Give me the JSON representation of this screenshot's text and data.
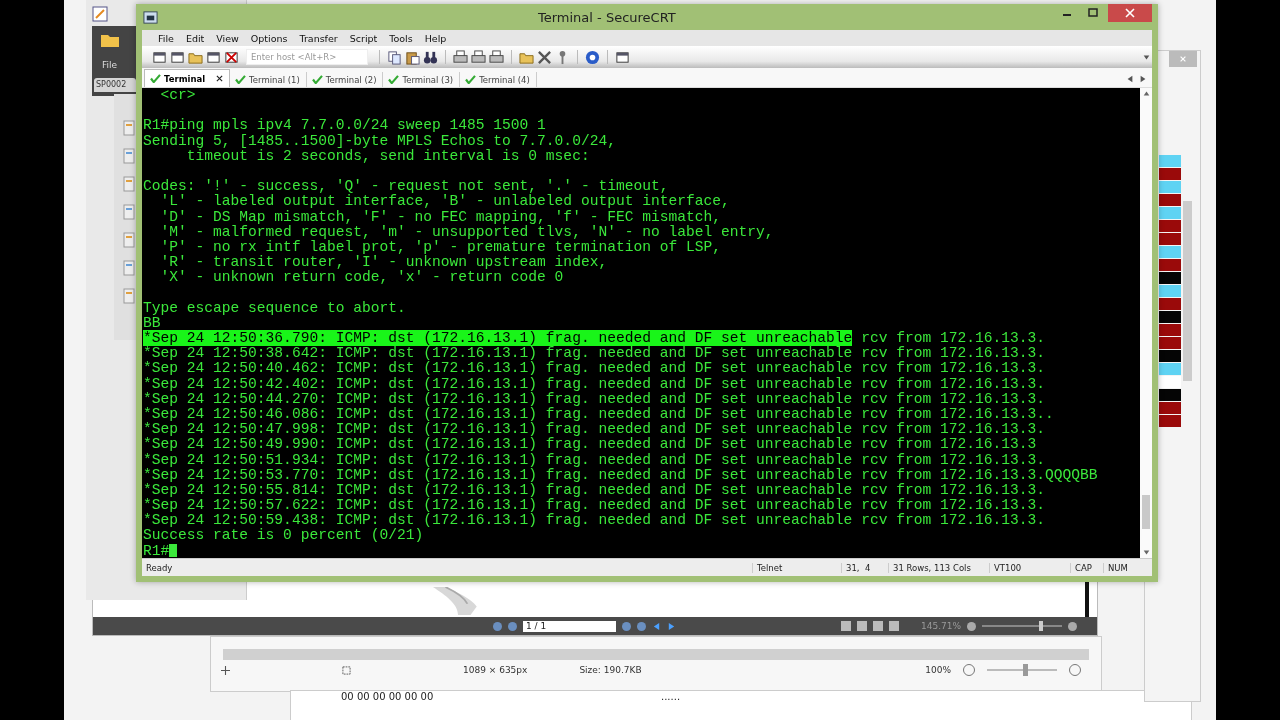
{
  "back_explorer": {
    "menu": "File",
    "tab": "SP0002"
  },
  "pdf_viewer": {
    "page": "1 / 1",
    "zoom": "145.71%",
    "zoom_slider": {
      "level": 0.75
    }
  },
  "image_viewer": {
    "dimensions": "1089 × 635px",
    "size": "Size: 190.7KB",
    "zoom": "100%",
    "zoom_slider": {
      "level": 0.55
    }
  },
  "hex_view": {
    "bytes": "00 00 00 00 00 00",
    "ascii": "......"
  },
  "color_strips": [
    {
      "color": "#5fd3f3"
    },
    {
      "color": "#9a0a0a"
    },
    {
      "color": "#5fd3f3"
    },
    {
      "color": "#9a0a0a"
    },
    {
      "color": "#5fd3f3"
    },
    {
      "color": "#9a0a0a"
    },
    {
      "color": "#9a0a0a"
    },
    {
      "color": "#5fd3f3"
    },
    {
      "color": "#9a0a0a"
    },
    {
      "color": "#050505"
    },
    {
      "color": "#5fd3f3"
    },
    {
      "color": "#9a0a0a"
    },
    {
      "color": "#050505"
    },
    {
      "color": "#9a0a0a"
    },
    {
      "color": "#9a0a0a"
    },
    {
      "color": "#050505"
    },
    {
      "color": "#5fd3f3"
    },
    {
      "color": "#ffffff"
    },
    {
      "color": "#050505"
    },
    {
      "color": "#9a0a0a"
    },
    {
      "color": "#9a0a0a"
    }
  ],
  "window": {
    "title": "Terminal - SecureCRT"
  },
  "menu": [
    "File",
    "Edit",
    "View",
    "Options",
    "Transfer",
    "Script",
    "Tools",
    "Help"
  ],
  "toolbar": {
    "host_placeholder": "Enter host <Alt+R>"
  },
  "tabs": [
    {
      "label": "Terminal",
      "selected": true
    },
    {
      "label": "Terminal (1)",
      "selected": false
    },
    {
      "label": "Terminal (2)",
      "selected": false
    },
    {
      "label": "Terminal (3)",
      "selected": false
    },
    {
      "label": "Terminal (4)",
      "selected": false
    }
  ],
  "terminal": {
    "cursor_visible": true,
    "blocks": [
      [
        {
          "text": "  <cr>"
        }
      ],
      [
        {
          "text": "R1#ping mpls ipv4 7.7.0.0/24 sweep 1485 1500 1"
        },
        {
          "text": "Sending 5, [1485..1500]-byte MPLS Echos to 7.7.0.0/24,"
        },
        {
          "text": "     timeout is 2 seconds, send interval is 0 msec:"
        }
      ],
      [
        {
          "text": "Codes: '!' - success, 'Q' - request not sent, '.' - timeout,"
        },
        {
          "text": "  'L' - labeled output interface, 'B' - unlabeled output interface,"
        },
        {
          "text": "  'D' - DS Map mismatch, 'F' - no FEC mapping, 'f' - FEC mismatch,"
        },
        {
          "text": "  'M' - malformed request, 'm' - unsupported tlvs, 'N' - no label entry,"
        },
        {
          "text": "  'P' - no rx intf label prot, 'p' - premature termination of LSP,"
        },
        {
          "text": "  'R' - transit router, 'I' - unknown upstream index,"
        },
        {
          "text": "  'X' - unknown return code, 'x' - return code 0"
        }
      ],
      [
        {
          "text": "Type escape sequence to abort."
        },
        {
          "text": "BB"
        },
        {
          "highlight": "*Sep 24 12:50:36.790: ICMP: dst (172.16.13.1) frag. needed and DF set unreachable",
          "text": " rcv from 172.16.13.3."
        },
        {
          "text": "*Sep 24 12:50:38.642: ICMP: dst (172.16.13.1) frag. needed and DF set unreachable rcv from 172.16.13.3."
        },
        {
          "text": "*Sep 24 12:50:40.462: ICMP: dst (172.16.13.1) frag. needed and DF set unreachable rcv from 172.16.13.3."
        },
        {
          "text": "*Sep 24 12:50:42.402: ICMP: dst (172.16.13.1) frag. needed and DF set unreachable rcv from 172.16.13.3."
        },
        {
          "text": "*Sep 24 12:50:44.270: ICMP: dst (172.16.13.1) frag. needed and DF set unreachable rcv from 172.16.13.3."
        },
        {
          "text": "*Sep 24 12:50:46.086: ICMP: dst (172.16.13.1) frag. needed and DF set unreachable rcv from 172.16.13.3.."
        },
        {
          "text": "*Sep 24 12:50:47.998: ICMP: dst (172.16.13.1) frag. needed and DF set unreachable rcv from 172.16.13.3."
        },
        {
          "text": "*Sep 24 12:50:49.990: ICMP: dst (172.16.13.1) frag. needed and DF set unreachable rcv from 172.16.13.3"
        },
        {
          "text": "*Sep 24 12:50:51.934: ICMP: dst (172.16.13.1) frag. needed and DF set unreachable rcv from 172.16.13.3."
        },
        {
          "text": "*Sep 24 12:50:53.770: ICMP: dst (172.16.13.1) frag. needed and DF set unreachable rcv from 172.16.13.3.QQQQBB"
        },
        {
          "text": "*Sep 24 12:50:55.814: ICMP: dst (172.16.13.1) frag. needed and DF set unreachable rcv from 172.16.13.3."
        },
        {
          "text": "*Sep 24 12:50:57.622: ICMP: dst (172.16.13.1) frag. needed and DF set unreachable rcv from 172.16.13.3."
        },
        {
          "text": "*Sep 24 12:50:59.438: ICMP: dst (172.16.13.1) frag. needed and DF set unreachable rcv from 172.16.13.3."
        },
        {
          "text": "Success rate is 0 percent (0/21)"
        },
        {
          "text": "R1#"
        }
      ]
    ]
  },
  "status_bar": {
    "message": "Ready",
    "protocol": "Telnet",
    "position": "31,  4",
    "size": "31 Rows, 113 Cols",
    "emulation": "VT100",
    "caps": "CAP",
    "num": "NUM"
  }
}
